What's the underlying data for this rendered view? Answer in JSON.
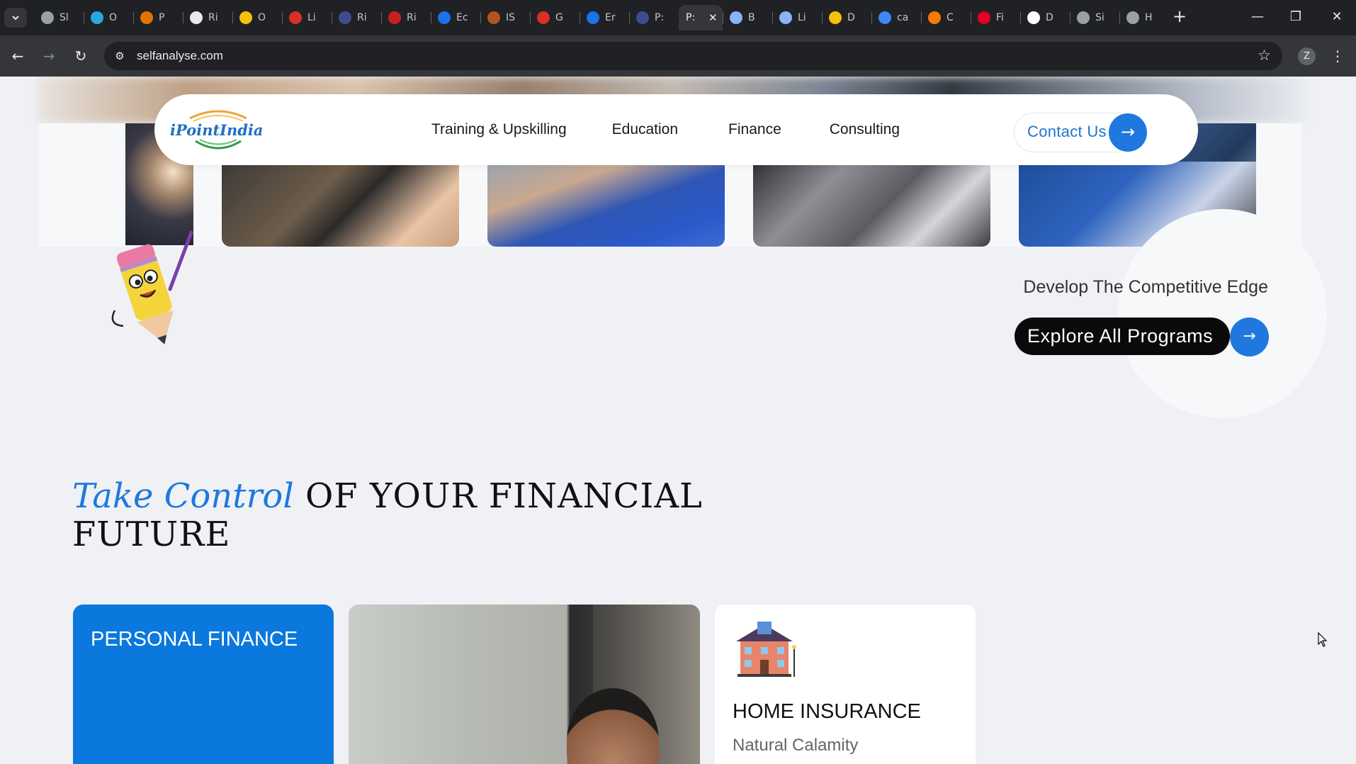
{
  "browser": {
    "tabs": [
      {
        "title": "Sl",
        "color": "#9aa0a6"
      },
      {
        "title": "O",
        "color": "#29a8e0"
      },
      {
        "title": "P",
        "color": "#e37400"
      },
      {
        "title": "Ri",
        "color": "#e8eaed"
      },
      {
        "title": "O",
        "color": "#f4c20d"
      },
      {
        "title": "Li",
        "color": "#d93025"
      },
      {
        "title": "Ri",
        "color": "#3c4d8f"
      },
      {
        "title": "Ri",
        "color": "#c5221f"
      },
      {
        "title": "Ec",
        "color": "#1a73e8"
      },
      {
        "title": "IS",
        "color": "#b3541e"
      },
      {
        "title": "G",
        "color": "#d93025"
      },
      {
        "title": "Er",
        "color": "#1a73e8"
      },
      {
        "title": "P:",
        "color": "#3c4d8f"
      },
      {
        "title": "P:",
        "color": "#9aa0a6",
        "active": true
      },
      {
        "title": "B",
        "color": "#8ab4f8"
      },
      {
        "title": "Li",
        "color": "#8ab4f8"
      },
      {
        "title": "D",
        "color": "#f4c20d"
      },
      {
        "title": "ca",
        "color": "#4285f4"
      },
      {
        "title": "C",
        "color": "#f57c00"
      },
      {
        "title": "Fi",
        "color": "#e60023"
      },
      {
        "title": "D",
        "color": "#ffffff"
      },
      {
        "title": "Si",
        "color": "#9aa0a6"
      },
      {
        "title": "H",
        "color": "#9aa0a6"
      }
    ],
    "url": "selfanalyse.com",
    "profile_initial": "Z"
  },
  "site": {
    "logo_text": "iPointIndia",
    "nav": [
      "Training & Upskilling",
      "Education",
      "Finance",
      "Consulting"
    ],
    "contact_label": "Contact Us",
    "accent": "#1f78dd"
  },
  "hero": {
    "tagline": "Develop The Competitive Edge",
    "explore_label": "Explore All Programs"
  },
  "section": {
    "heading_script": "Take Control",
    "heading_rest_line1": " OF YOUR FINANCIAL",
    "heading_rest_line2": "FUTURE"
  },
  "cards": {
    "personal_finance": "PERSONAL FINANCE",
    "home_insurance_title": "HOME INSURANCE",
    "home_insurance_sub": "Natural Calamity"
  }
}
